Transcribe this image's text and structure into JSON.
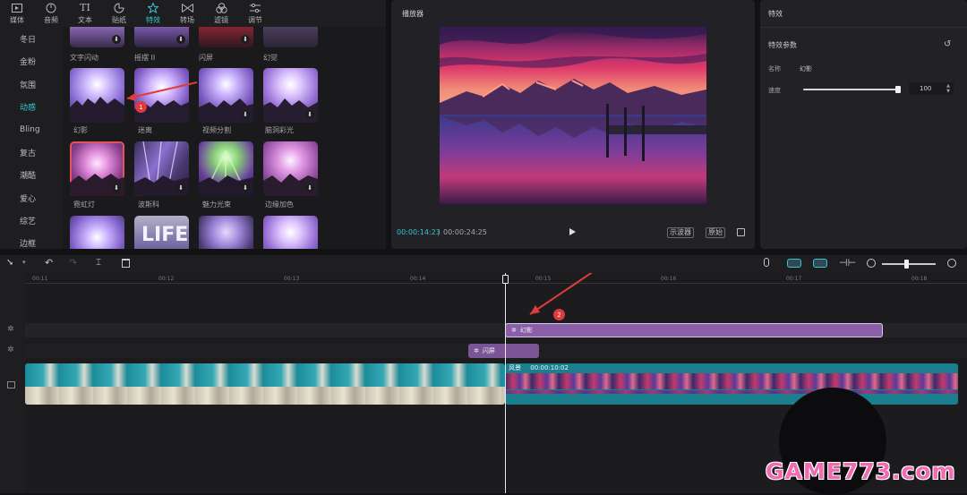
{
  "toolbar": {
    "tools": [
      {
        "label": "媒体",
        "icon": "media-icon"
      },
      {
        "label": "音频",
        "icon": "audio-icon"
      },
      {
        "label": "文本",
        "icon": "text-icon"
      },
      {
        "label": "贴纸",
        "icon": "sticker-icon"
      },
      {
        "label": "特效",
        "icon": "effects-icon"
      },
      {
        "label": "转场",
        "icon": "transition-icon"
      },
      {
        "label": "滤镜",
        "icon": "filter-icon"
      },
      {
        "label": "调节",
        "icon": "adjust-icon"
      }
    ],
    "active_tool": "特效"
  },
  "categories": [
    "冬日",
    "金粉",
    "氛围",
    "动感",
    "Bling",
    "复古",
    "潮酷",
    "爱心",
    "综艺",
    "边框"
  ],
  "active_category": "动感",
  "effects": {
    "top_labels": [
      "文字闪动",
      "摇摆 II",
      "闪屏",
      "幻觉"
    ],
    "row1_labels": [
      "幻影",
      "迷离",
      "视频分割",
      "脑洞彩光"
    ],
    "row2_labels": [
      "霓虹灯",
      "波斯科",
      "魅力光束",
      "边缘加色"
    ],
    "selected_index": 4,
    "badges": {
      "marker1": "1",
      "marker2": "2"
    }
  },
  "player": {
    "title": "播放器",
    "current_time": "00:00:14:23",
    "separator": "|",
    "total_time": "00:00:24:25",
    "btn_scope": "示波器",
    "btn_original": "原始"
  },
  "props": {
    "header": "特效",
    "section_title": "特效参数",
    "name_label": "名称",
    "name_value": "幻影",
    "speed_label": "速度",
    "speed_value": "100",
    "speed_level": 1.0
  },
  "timeline": {
    "ticks": [
      "00:11",
      "00:12",
      "00:13",
      "00:14",
      "00:15",
      "00:16",
      "00:17",
      "00:18"
    ],
    "effect_clip_1": "幻影",
    "effect_clip_2": "闪屏",
    "video_clip_label": "风景",
    "video_clip_time": "00:00:10:02"
  },
  "watermark": "GAME773.com"
}
